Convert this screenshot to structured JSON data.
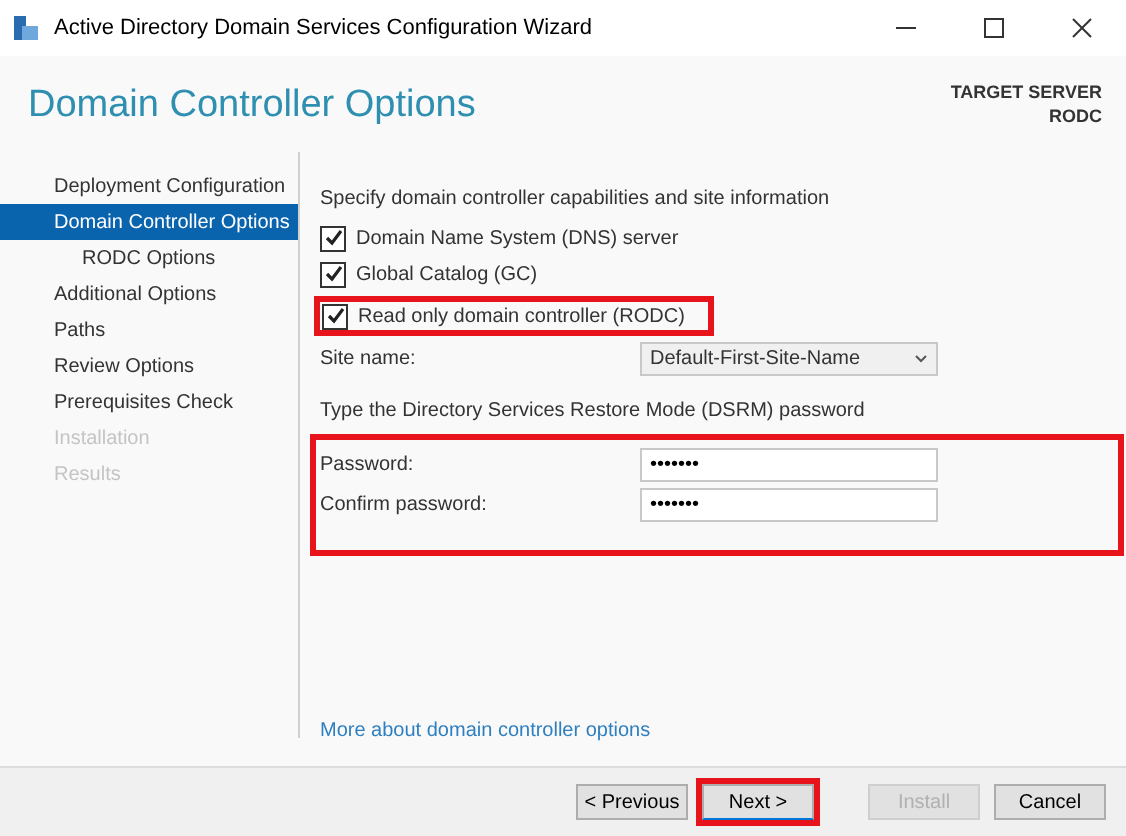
{
  "window": {
    "title": "Active Directory Domain Services Configuration Wizard"
  },
  "header": {
    "title": "Domain Controller Options",
    "target_label": "TARGET SERVER",
    "target_name": "RODC"
  },
  "sidebar": {
    "items": [
      {
        "label": "Deployment Configuration",
        "selected": false,
        "disabled": false
      },
      {
        "label": "Domain Controller Options",
        "selected": true,
        "disabled": false,
        "children": [
          {
            "label": "RODC Options",
            "selected": false,
            "disabled": false
          }
        ]
      },
      {
        "label": "Additional Options",
        "selected": false,
        "disabled": false
      },
      {
        "label": "Paths",
        "selected": false,
        "disabled": false
      },
      {
        "label": "Review Options",
        "selected": false,
        "disabled": false
      },
      {
        "label": "Prerequisites Check",
        "selected": false,
        "disabled": false
      },
      {
        "label": "Installation",
        "selected": false,
        "disabled": true
      },
      {
        "label": "Results",
        "selected": false,
        "disabled": true
      }
    ]
  },
  "capabilities": {
    "heading": "Specify domain controller capabilities and site information",
    "options": [
      {
        "label": "Domain Name System (DNS) server",
        "checked": true,
        "highlighted": false
      },
      {
        "label": "Global Catalog (GC)",
        "checked": true,
        "highlighted": false
      },
      {
        "label": "Read only domain controller (RODC)",
        "checked": true,
        "highlighted": true
      }
    ],
    "site": {
      "label": "Site name:",
      "value": "Default-First-Site-Name"
    }
  },
  "dsrm": {
    "heading": "Type the Directory Services Restore Mode (DSRM) password",
    "highlighted": true,
    "fields": [
      {
        "label": "Password:",
        "value": "•••••••"
      },
      {
        "label": "Confirm password:",
        "value": "•••••••"
      }
    ]
  },
  "more_link": "More about domain controller options",
  "buttons": [
    {
      "label": "< Previous",
      "disabled": false,
      "highlighted": false
    },
    {
      "label": "Next >",
      "disabled": false,
      "highlighted": true
    },
    {
      "label": "Install",
      "disabled": true,
      "highlighted": false
    },
    {
      "label": "Cancel",
      "disabled": false,
      "highlighted": false
    }
  ]
}
